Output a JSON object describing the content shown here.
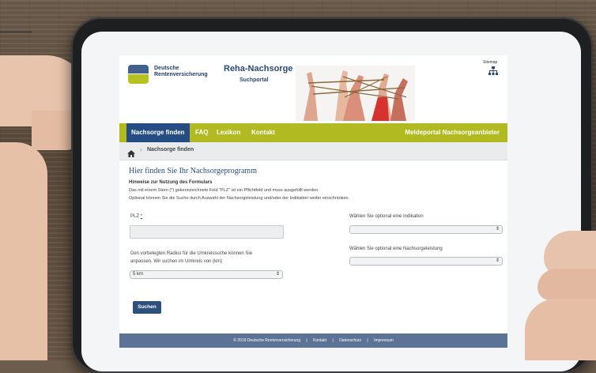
{
  "header": {
    "logo_line1": "Deutsche",
    "logo_line2": "Rentenversicherung",
    "title": "Reha-Nachsorge",
    "subtitle": "Suchportal",
    "sitemap_label": "Sitemap"
  },
  "nav": {
    "items": [
      "Nachsorge finden",
      "FAQ",
      "Lexikon",
      "Kontakt"
    ],
    "right_link": "Meldeportal Nachsorgeanbieter"
  },
  "breadcrumb": {
    "current": "Nachsorge finden"
  },
  "content": {
    "title": "Hier finden Sie Ihr Nachsorgeprogramm",
    "hint_heading": "Hinweise zur Nutzung des Formulars",
    "hint_line1": "Das mit einem Stern (*) gekennzeichnete Feld \"PLZ\" ist ein Pflichtfeld und muss ausgefüllt werden.",
    "hint_line2": "Optional können Sie die Suche durch Auswahl der Nachsorgeleistung und/oder der Indikation weiter einschränken."
  },
  "form": {
    "plz_label": "PLZ",
    "plz_required_mark": "*",
    "plz_value": "",
    "radius_text_line1": "Den vorbelegten Radius für die Umkreissuche können Sie",
    "radius_text_line2": "anpassen. Wir suchen im Umkreis von (km)",
    "radius_value": "5 km",
    "indikation_label": "Wählen Sie optional eine Indikation",
    "indikation_value": "",
    "leistung_label": "Wählen Sie optional eine Nachsorgeleistung",
    "leistung_value": "",
    "submit_label": "Suchen"
  },
  "footer": {
    "copyright": "© 2019 Deutsche Rentenversicherung",
    "links": [
      "Kontakt",
      "Datenschutz",
      "Impressum"
    ],
    "separator": "|"
  },
  "icons": {
    "home": "home-icon",
    "sitemap": "sitemap-icon",
    "select_arrow": "select-arrow-icon"
  },
  "colors": {
    "nav_green": "#b2ba21",
    "nav_active_blue": "#264d83",
    "footer_blue": "#5d7395",
    "button_blue": "#2e507f"
  }
}
